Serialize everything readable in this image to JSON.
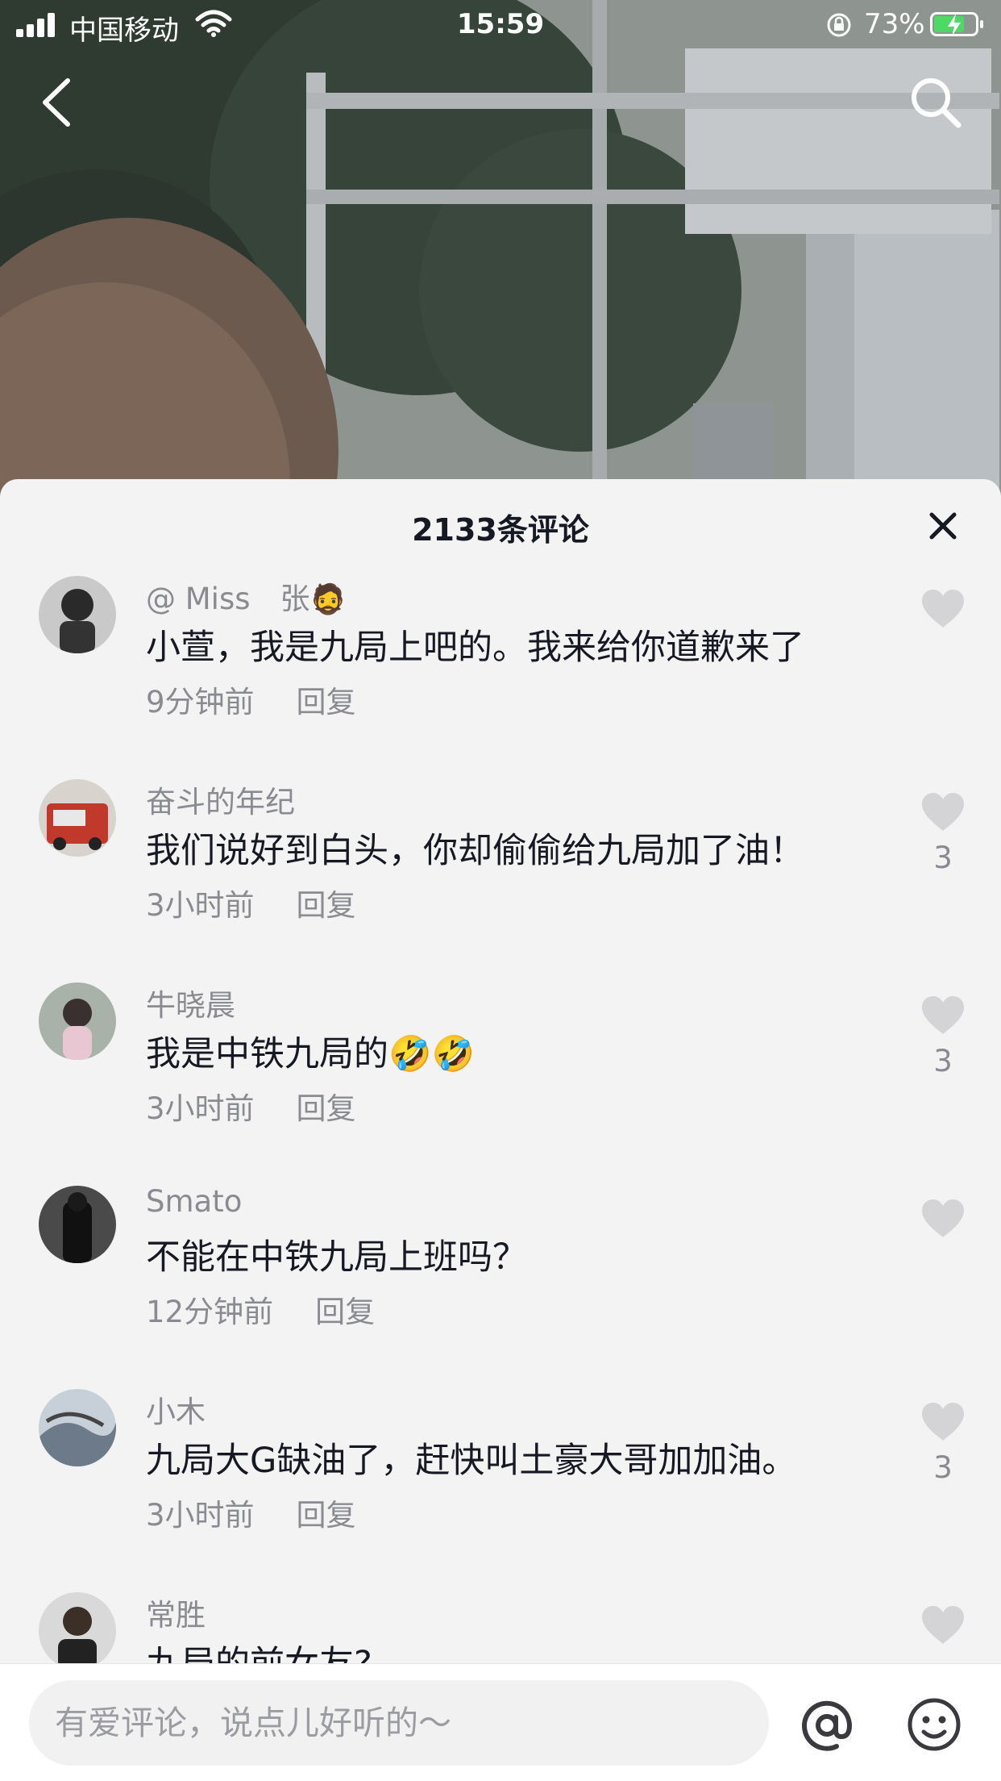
{
  "status_bar": {
    "carrier": "中国移动",
    "time": "15:59",
    "battery": "73%",
    "battery_level": 0.73
  },
  "icons": {
    "back": "chevron-left-icon",
    "search": "search-icon",
    "close": "close-icon",
    "like": "heart-icon",
    "mention": "at-icon",
    "emoji": "smiley-icon"
  },
  "colors": {
    "sheet_bg": "#f3f3f3",
    "primary_text": "#161823",
    "secondary_text": "#8a8b91",
    "heart": "#d4d4d6"
  },
  "comments_sheet": {
    "title": "2133条评论",
    "comments": [
      {
        "username": "@ Miss　张",
        "username_emoji": "🧔",
        "text": "小萱，我是九局上吧的。我来给你道歉来了",
        "time": "9分钟前",
        "reply": "回复",
        "likes": ""
      },
      {
        "username": "奋斗的年纪",
        "username_emoji": "",
        "text": "我们说好到白头，你却偷偷给九局加了油！",
        "time": "3小时前",
        "reply": "回复",
        "likes": "3"
      },
      {
        "username": "牛晓晨",
        "username_emoji": "",
        "text": "我是中铁九局的🤣🤣",
        "time": "3小时前",
        "reply": "回复",
        "likes": "3"
      },
      {
        "username": "Smato",
        "username_emoji": "",
        "text": "不能在中铁九局上班吗？",
        "time": "12分钟前",
        "reply": "回复",
        "likes": ""
      },
      {
        "username": "小木",
        "username_emoji": "",
        "text": "九局大G缺油了，赶快叫土豪大哥加加油。",
        "time": "3小时前",
        "reply": "回复",
        "likes": "3"
      },
      {
        "username": "常胜",
        "username_emoji": "",
        "text": "九局的前女友?",
        "time": "",
        "reply": "",
        "likes": ""
      }
    ]
  },
  "input_bar": {
    "placeholder": "有爱评论，说点儿好听的～"
  }
}
